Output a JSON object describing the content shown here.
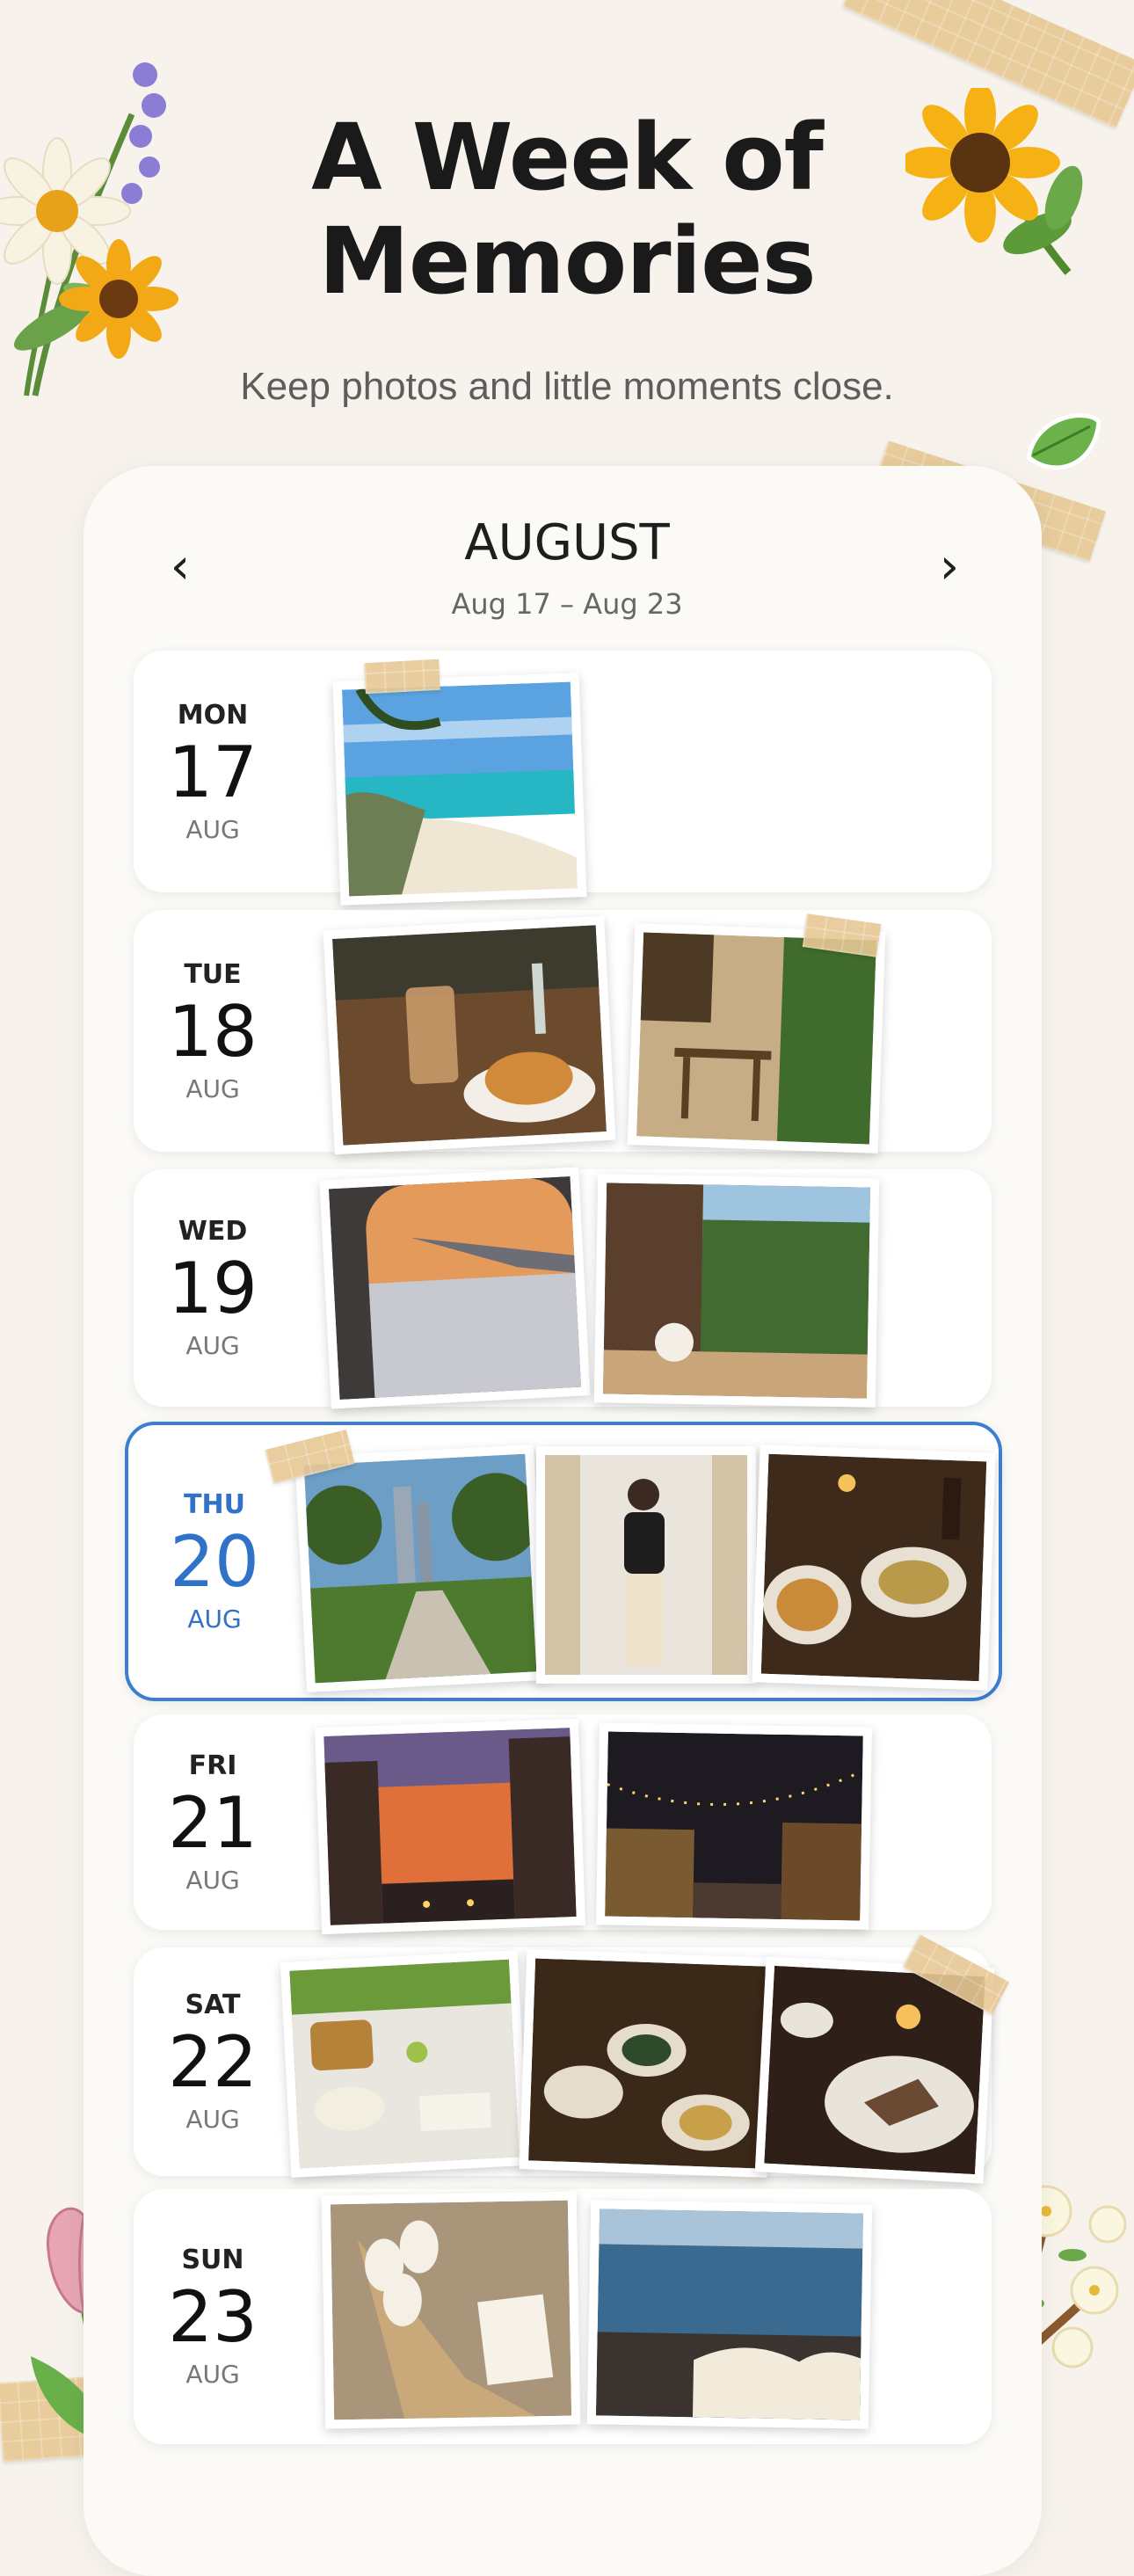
{
  "header": {
    "title_line1": "A Week of",
    "title_line2": "Memories",
    "subtitle": "Keep photos and little moments close."
  },
  "calendar": {
    "month": "AUGUST",
    "range": "Aug 17 – Aug 23",
    "prev_icon": "chevron-left-icon",
    "next_icon": "chevron-right-icon",
    "selected_color": "#3b7ed4",
    "days": [
      {
        "dow": "MON",
        "num": "17",
        "mon": "AUG",
        "photos": [
          "beach",
          "",
          ""
        ]
      },
      {
        "dow": "TUE",
        "num": "18",
        "mon": "AUG",
        "photos": [
          "iced-coffee-croissant",
          "cafe-terrace"
        ]
      },
      {
        "dow": "WED",
        "num": "19",
        "mon": "AUG",
        "photos": [
          "airplane-window",
          "train-window"
        ]
      },
      {
        "dow": "THU",
        "num": "20",
        "mon": "AUG",
        "photos": [
          "city-park",
          "mirror-selfie",
          "dinner-table"
        ],
        "selected": true
      },
      {
        "dow": "FRI",
        "num": "21",
        "mon": "AUG",
        "photos": [
          "sunset-street",
          "night-market"
        ]
      },
      {
        "dow": "SAT",
        "num": "22",
        "mon": "AUG",
        "photos": [
          "picnic",
          "dinner-friends",
          "cake-dessert"
        ]
      },
      {
        "dow": "SUN",
        "num": "23",
        "mon": "AUG",
        "photos": [
          "tulips-letter",
          "sea-book"
        ]
      }
    ]
  }
}
